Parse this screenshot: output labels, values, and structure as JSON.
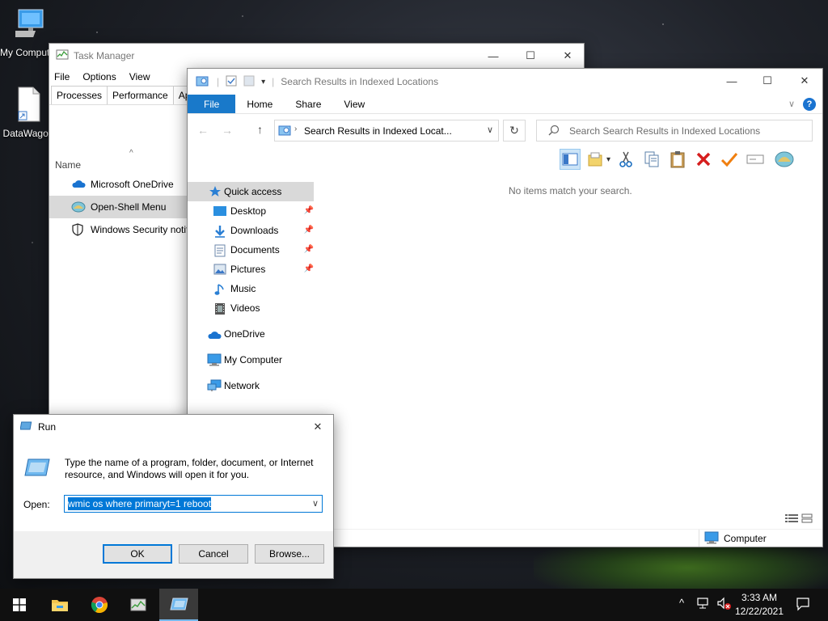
{
  "desktop": {
    "icons": [
      {
        "label": "My Computer",
        "icon": "computer-icon"
      },
      {
        "label": "DataWagon",
        "icon": "file-shortcut-icon"
      }
    ]
  },
  "task_manager": {
    "title": "Task Manager",
    "menu": [
      "File",
      "Options",
      "View"
    ],
    "tabs": [
      "Processes",
      "Performance",
      "App"
    ],
    "column_header": "Name",
    "rows": [
      {
        "label": "Microsoft OneDrive",
        "icon": "onedrive-icon"
      },
      {
        "label": "Open-Shell Menu",
        "icon": "open-shell-icon",
        "selected": true
      },
      {
        "label": "Windows Security notif",
        "icon": "shield-icon"
      }
    ]
  },
  "explorer": {
    "title": "Search Results in Indexed Locations",
    "ribbon_tabs": [
      "File",
      "Home",
      "Share",
      "View"
    ],
    "address": "Search Results in Indexed Locat...",
    "search_placeholder": "Search Search Results in Indexed Locations",
    "empty_message": "No items match your search.",
    "nav": {
      "quick_access": "Quick access",
      "pinned": [
        {
          "label": "Desktop",
          "icon": "desktop-folder-icon",
          "pinned": true
        },
        {
          "label": "Downloads",
          "icon": "downloads-icon",
          "pinned": true
        },
        {
          "label": "Documents",
          "icon": "documents-icon",
          "pinned": true
        },
        {
          "label": "Pictures",
          "icon": "pictures-icon",
          "pinned": true
        },
        {
          "label": "Music",
          "icon": "music-icon",
          "pinned": false
        },
        {
          "label": "Videos",
          "icon": "videos-icon",
          "pinned": false
        }
      ],
      "onedrive": "OneDrive",
      "my_computer": "My Computer",
      "network": "Network"
    },
    "status": "Computer"
  },
  "run_dialog": {
    "title": "Run",
    "description": "Type the name of a program, folder, document, or Internet resource, and Windows will open it for you.",
    "open_label": "Open:",
    "input_value": "wmic os where primaryt=1 reboot",
    "buttons": {
      "ok": "OK",
      "cancel": "Cancel",
      "browse": "Browse..."
    }
  },
  "taskbar": {
    "time": "3:33 AM",
    "date": "12/22/2021"
  },
  "colors": {
    "accent": "#0078d7",
    "file_tab": "#1979ca",
    "delete_red": "#d61e1e",
    "check_orange": "#f07f10"
  }
}
